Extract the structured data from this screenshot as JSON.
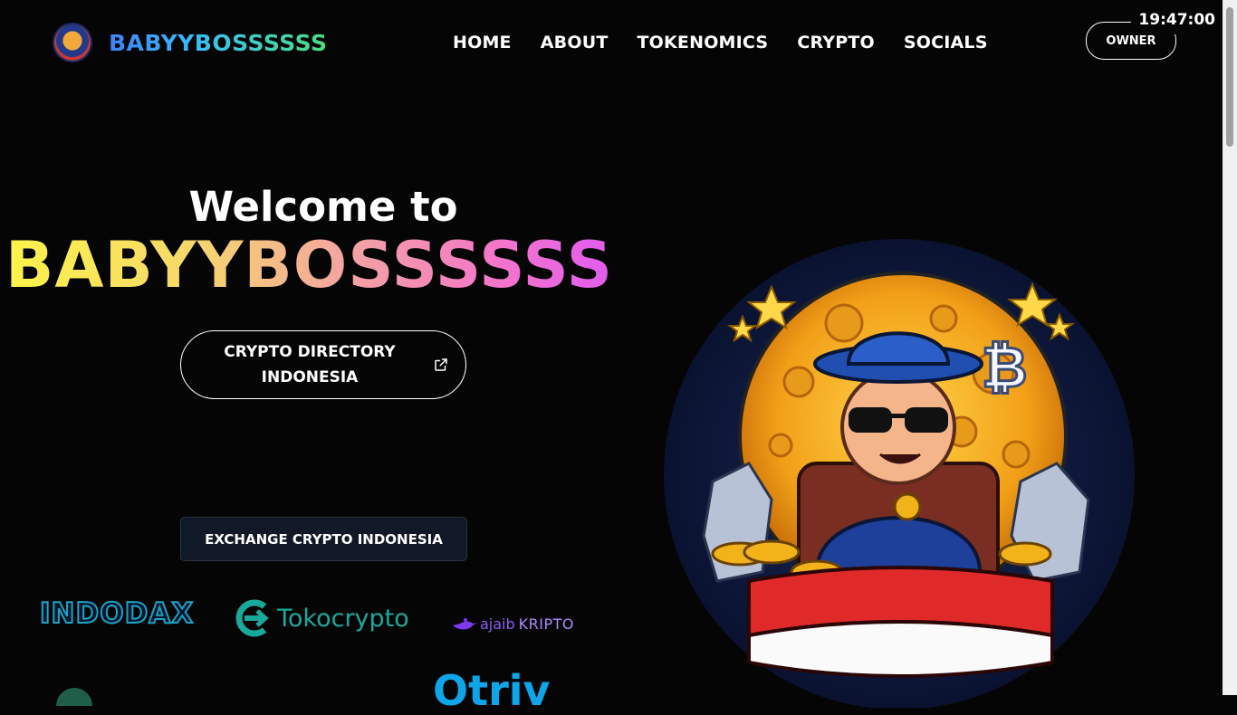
{
  "brand": {
    "name": "BABYYBOSSSSSS",
    "logo_icon": "baby-boss-logo-icon"
  },
  "nav": {
    "items": [
      "HOME",
      "ABOUT",
      "TOKENOMICS",
      "CRYPTO",
      "SOCIALS"
    ]
  },
  "header": {
    "owner_label": "OWNER",
    "clock": "19:47:00"
  },
  "hero": {
    "welcome": "Welcome to",
    "title": "BABYYBOSSSSSS",
    "directory_button_line1": "CRYPTO DIRECTORY",
    "directory_button_line2": "INDONESIA",
    "directory_icon": "external-link-icon",
    "exchange_button": "EXCHANGE CRYPTO INDONESIA"
  },
  "exchanges": {
    "indodax": "INDODAX",
    "tokocrypto": "Tokocrypto",
    "ajaib_prefix": "ajaib",
    "ajaib_suffix": "KRIPTO",
    "triv": "Otriv"
  },
  "colors": {
    "background": "#050505",
    "brand_gradient": [
      "#3b82f6",
      "#4ade80"
    ],
    "title_gradient": [
      "#fff34a",
      "#e25bf0"
    ],
    "indodax": "#1aa3c8",
    "tokocrypto": "#1aa89b",
    "ajaib": "#8b5cf6",
    "triv": "#0ea5e9"
  }
}
